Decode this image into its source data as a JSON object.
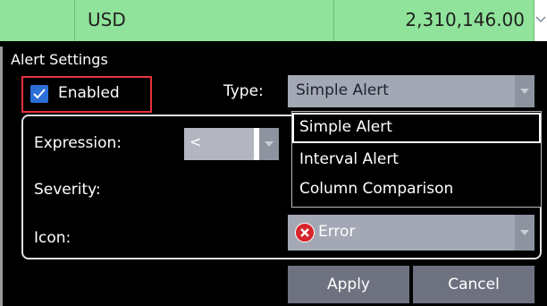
{
  "grid_row": {
    "currency": "USD",
    "amount": "2,310,146.00"
  },
  "alert_settings": {
    "title": "Alert Settings",
    "enabled_label": "Enabled",
    "enabled_checked": true,
    "type_label": "Type:",
    "type_value": "Simple Alert",
    "type_options": [
      "Simple Alert",
      "Interval Alert",
      "Column Comparison"
    ],
    "expression_label": "Expression:",
    "expression_value": "<",
    "severity_label": "Severity:",
    "icon_label": "Icon:",
    "icon_value": "Error",
    "icon_icon": "error-x-icon"
  },
  "buttons": {
    "apply": "Apply",
    "cancel": "Cancel"
  },
  "colors": {
    "row_green": "#90e39a",
    "highlight_red": "#e8323c",
    "checkbox_blue": "#2b6fd6",
    "button_gray": "#6e7280",
    "select_gray": "#a4a8b4"
  }
}
